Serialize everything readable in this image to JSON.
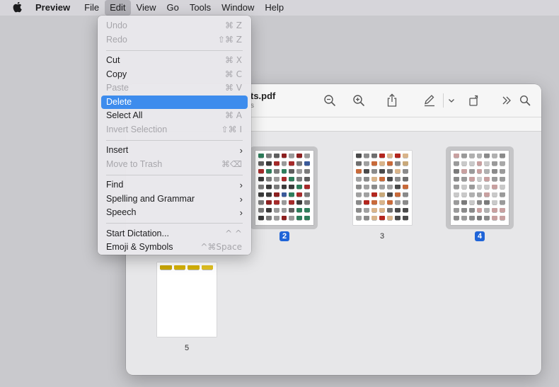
{
  "menubar": {
    "app_name": "Preview",
    "menus": [
      "File",
      "Edit",
      "View",
      "Go",
      "Tools",
      "Window",
      "Help"
    ],
    "active_menu": "Edit"
  },
  "edit_menu": {
    "undo": {
      "label": "Undo",
      "shortcut": "⌘ Z"
    },
    "redo": {
      "label": "Redo",
      "shortcut": "⇧⌘ Z"
    },
    "cut": {
      "label": "Cut",
      "shortcut": "⌘ X"
    },
    "copy": {
      "label": "Copy",
      "shortcut": "⌘ C"
    },
    "paste": {
      "label": "Paste",
      "shortcut": "⌘ V"
    },
    "delete": {
      "label": "Delete"
    },
    "select_all": {
      "label": "Select All",
      "shortcut": "⌘ A"
    },
    "invert_selection": {
      "label": "Invert Selection",
      "shortcut": "⇧⌘ I"
    },
    "insert": {
      "label": "Insert"
    },
    "move_to_trash": {
      "label": "Move to Trash",
      "shortcut": "⌘⌫"
    },
    "find": {
      "label": "Find"
    },
    "spelling": {
      "label": "Spelling and Grammar"
    },
    "speech": {
      "label": "Speech"
    },
    "dictation": {
      "label": "Start Dictation...",
      "shortcut": "^ ^"
    },
    "emoji": {
      "label": "Emoji & Symbols",
      "shortcut": "^⌘Space"
    }
  },
  "window": {
    "title": "ts.pdf",
    "subtitle": "s"
  },
  "pages": [
    {
      "number": "2",
      "selected": true
    },
    {
      "number": "3",
      "selected": false
    },
    {
      "number": "4",
      "selected": true
    },
    {
      "number": "5",
      "selected": false
    }
  ],
  "colors": {
    "accent": "#1f64d8",
    "highlight": "#3d8ced"
  }
}
